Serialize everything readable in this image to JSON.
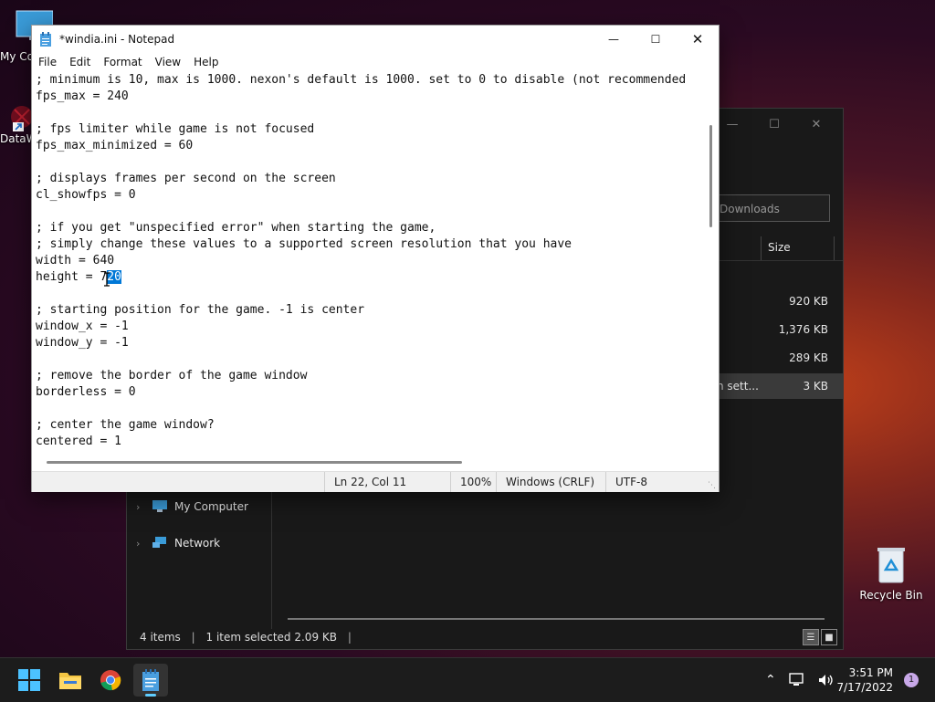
{
  "desktop": {
    "icons": [
      {
        "label": "My Co"
      },
      {
        "label": "DataW"
      },
      {
        "label": "Recycle Bin"
      }
    ]
  },
  "explorer": {
    "search_placeholder": "Downloads",
    "column_size": "Size",
    "files": [
      {
        "name": "",
        "size": "920 KB",
        "selected": false
      },
      {
        "name": "",
        "size": "1,376 KB",
        "selected": false
      },
      {
        "name": "",
        "size": "289 KB",
        "selected": false
      },
      {
        "name": "n sett...",
        "size": "3 KB",
        "selected": true
      }
    ],
    "nav": [
      {
        "label": "My Computer"
      },
      {
        "label": "Network"
      }
    ],
    "status": {
      "items": "4 items",
      "selected": "1 item selected  2.09 KB"
    }
  },
  "notepad": {
    "title": "*windia.ini - Notepad",
    "menu": [
      "File",
      "Edit",
      "Format",
      "View",
      "Help"
    ],
    "lines": [
      "; minimum is 10, max is 1000. nexon's default is 1000. set to 0 to disable (not recommended",
      "fps_max = 240",
      "",
      "; fps limiter while game is not focused",
      "fps_max_minimized = 60",
      "",
      "; displays frames per second on the screen",
      "cl_showfps = 0",
      "",
      "; if you get \"unspecified error\" when starting the game,",
      "; simply change these values to a supported screen resolution that you have",
      "width = 640",
      "",
      "",
      "; starting position for the game. -1 is center",
      "window_x = -1",
      "window_y = -1",
      "",
      "; remove the border of the game window",
      "borderless = 0",
      "",
      "; center the game window?",
      "centered = 1"
    ],
    "height_line": {
      "prefix": "height = 7",
      "selected": "20"
    },
    "status": {
      "position": "Ln 22, Col 11",
      "zoom": "100%",
      "line_ending": "Windows (CRLF)",
      "encoding": "UTF-8"
    }
  },
  "taskbar": {
    "clock_time": "3:51 PM",
    "clock_date": "7/17/2022",
    "notification_count": "1"
  }
}
